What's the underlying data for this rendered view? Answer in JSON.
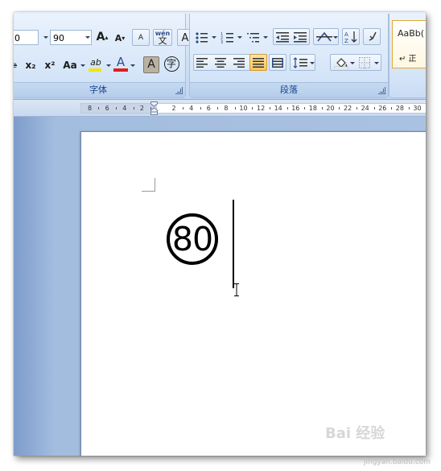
{
  "ribbon": {
    "font_group": {
      "label": "字体",
      "font_name_partial": "0",
      "font_size": "90",
      "grow_font_label": "A",
      "shrink_font_label": "A",
      "clear_format_label": "A",
      "phonetic_label": "wén",
      "phonetic_char": "文",
      "char_border_label": "A",
      "strike_label": "ab",
      "subscript_label": "x₂",
      "superscript_label": "x²",
      "change_case_label": "Aa",
      "highlight_label": "ab",
      "font_color_label": "A",
      "char_shading_label": "A",
      "enclose_char_label": "字"
    },
    "paragraph_group": {
      "label": "段落"
    },
    "styles_group": {
      "sample_text": "AaBb(",
      "style_name": "↵ 正"
    }
  },
  "ruler": {
    "ticks": [
      "8",
      "6",
      "4",
      "2",
      "2",
      "4",
      "6",
      "8",
      "10",
      "12",
      "14",
      "16",
      "18",
      "20",
      "22",
      "24",
      "26",
      "28",
      "30"
    ]
  },
  "document": {
    "enclosed_text": "80"
  },
  "watermark": {
    "brand": "Bai 经验",
    "url": "jingyan.baidu.com"
  },
  "colors": {
    "highlight": "#f2e60f",
    "font_color": "#e31c1c",
    "ribbon_label": "#15428b",
    "active_button": "#f7c55a"
  }
}
